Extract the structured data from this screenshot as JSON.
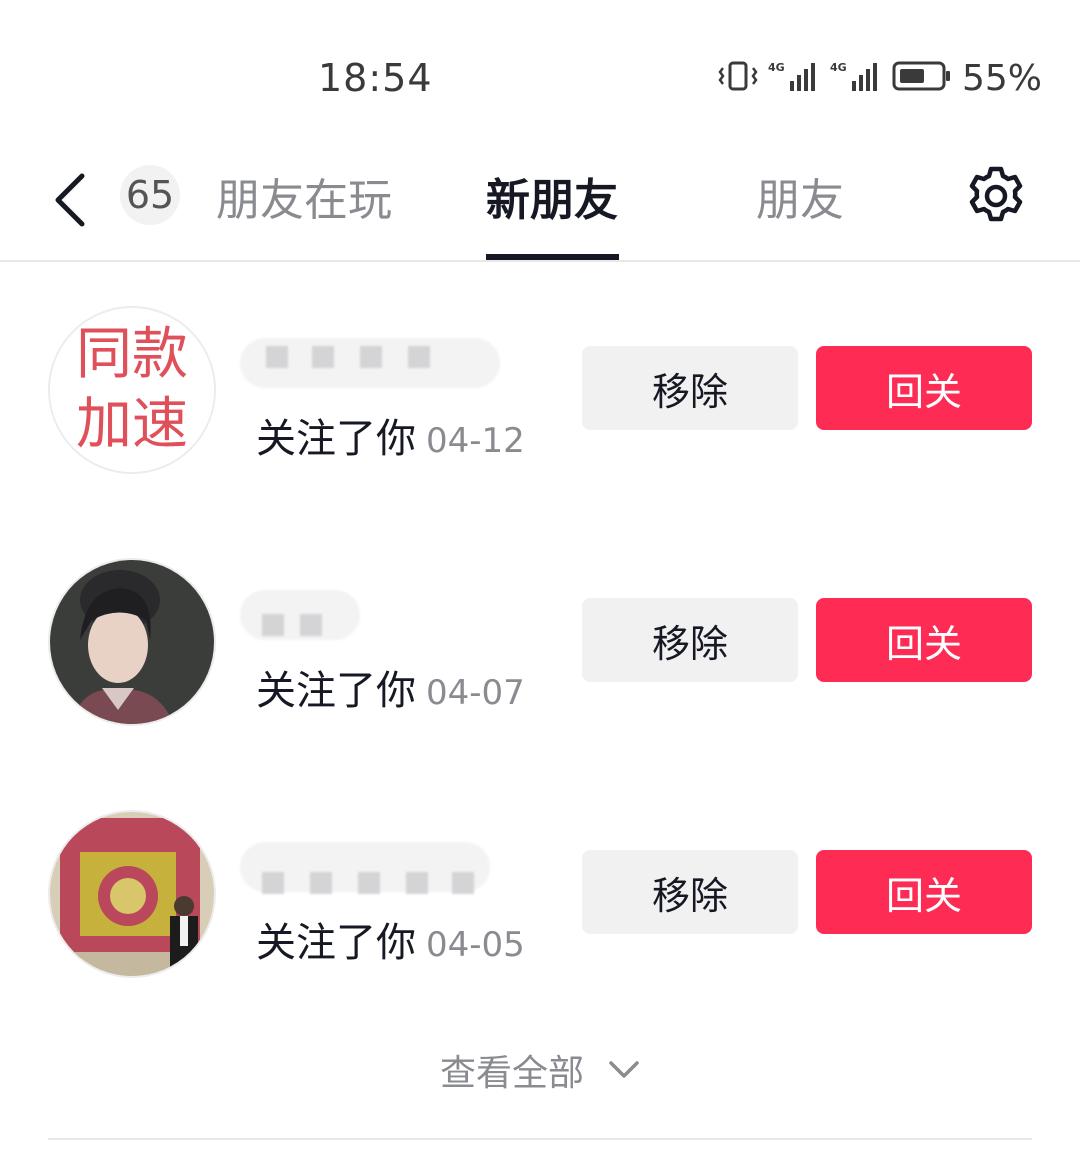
{
  "status_bar": {
    "time": "18:54",
    "battery_percent": "55%",
    "icons": [
      "vibrate-icon",
      "signal-4g-icon",
      "signal-4g-icon",
      "battery-icon"
    ]
  },
  "nav": {
    "count_badge": "65",
    "tabs": [
      {
        "label": "朋友在玩",
        "active": false
      },
      {
        "label": "新朋友",
        "active": true
      },
      {
        "label": "朋友",
        "active": false
      }
    ]
  },
  "friends": [
    {
      "avatar_text_line1": "同款",
      "avatar_text_line2": "加速",
      "follow_text": "关注了你",
      "date": "04-12",
      "remove_label": "移除",
      "follow_back_label": "回关"
    },
    {
      "follow_text": "关注了你",
      "date": "04-07",
      "remove_label": "移除",
      "follow_back_label": "回关"
    },
    {
      "follow_text": "关注了你",
      "date": "04-05",
      "remove_label": "移除",
      "follow_back_label": "回关"
    }
  ],
  "view_all_label": "查看全部",
  "colors": {
    "accent": "#fe2c55",
    "text_primary": "#161823",
    "text_secondary": "#8a8b91"
  }
}
